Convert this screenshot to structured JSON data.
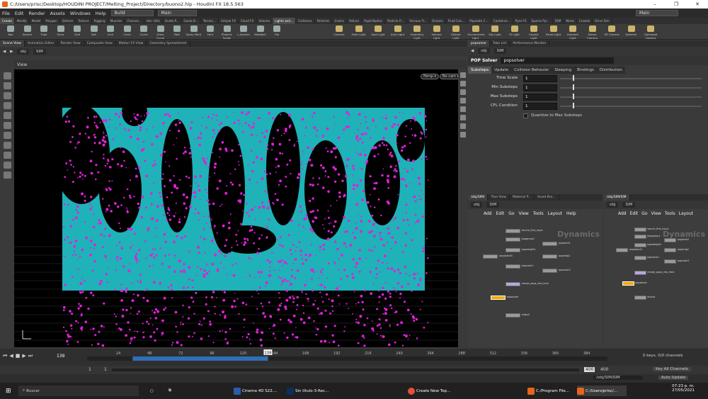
{
  "window": {
    "title": "C:/Users/prisc/Desktop/HOUDINI PROJECT/Melting_Project/Directory/buono2.hip - Houdini FX 18.5.563",
    "controls": [
      "–",
      "❐",
      "✕"
    ]
  },
  "menubar": {
    "items": [
      "File",
      "Edit",
      "Render",
      "Assets",
      "Windows",
      "Help"
    ],
    "build": "Build",
    "main": "Main",
    "main_right": "Main"
  },
  "shelf_tabs": [
    "Create",
    "Modify",
    "Model",
    "Polygon",
    "Deform",
    "Texture",
    "Rigging",
    "Muscles",
    "Charact...",
    "Hair Utils",
    "Guide P...",
    "Guide B...",
    "Terrain...",
    "Simple FX",
    "Cloud FX",
    "Volume",
    "Lights and...",
    "Collisions",
    "Particles",
    "Grains",
    "Vellum",
    "Rigid Bodies",
    "Particle Fl...",
    "Viscous Fl...",
    "Oceans",
    "Fluid Con...",
    "Populate C...",
    "Container...",
    "Pyro FX",
    "Sparse Pyr...",
    "FEM",
    "Wires",
    "Crowds",
    "Drive Sim"
  ],
  "tools_left": [
    "Box",
    "Sphere",
    "Tube",
    "Torus",
    "Grid",
    "Null",
    "Line",
    "Circle",
    "Curve",
    "Draw Curve",
    "Path",
    "Spray Paint",
    "Font",
    "Platonic Solids",
    "L-System",
    "Metaball",
    "File"
  ],
  "tools_right": [
    "Camera",
    "Point Light",
    "Spot Light",
    "Area Light",
    "Geometry Light",
    "Volume Light",
    "Distant Light",
    "Environment Light",
    "Sky Light",
    "GI Light",
    "Caustic Light",
    "Portal Light",
    "Ambient Light",
    "Stereo Camera",
    "VR Camera",
    "Switcher",
    "Gamepad Camera"
  ],
  "left_pane_tabs": [
    "Scene View",
    "Animation Editor",
    "Render View",
    "Composite View",
    "Motion FX View",
    "Geometry Spreadsheet"
  ],
  "path": {
    "obj": "obj",
    "sim": "SIM"
  },
  "viewport": {
    "label": "View",
    "persp": "Persp ▾",
    "cam": "No cam ▾"
  },
  "param_pane": {
    "tabs": [
      "popsolver",
      "Take List",
      "Performance Monitor"
    ],
    "node_type": "POP Solver",
    "node_name": "popsolver",
    "sub_tabs": [
      "Substeps",
      "Update",
      "Collision Behavior",
      "Sleeping",
      "Bindings",
      "Distribution"
    ],
    "params": [
      {
        "label": "Time Scale",
        "value": "1"
      },
      {
        "label": "Min Substeps",
        "value": "1"
      },
      {
        "label": "Max Substeps",
        "value": "1"
      },
      {
        "label": "CFL Condition",
        "value": "1"
      }
    ],
    "quantize": "Quantize to Max Substeps"
  },
  "net_left": {
    "tabs": [
      "/obj/SIM/",
      "Tree View",
      "Material P...",
      "Asset Bro..."
    ],
    "menu": [
      "Add",
      "Edit",
      "Go",
      "View",
      "Tools",
      "Layout",
      "Help"
    ],
    "watermark": "Dynamics",
    "nodes": [
      "source_first_input",
      "popgroup1",
      "popweight1",
      "popobject1",
      "popwind1",
      "popdrag1",
      "popcolor1",
      "popcolor2",
      "merge_pops_into_here",
      "popsolver",
      "output"
    ]
  },
  "net_right": {
    "tabs": [
      "/obj/SIM/SIM"
    ],
    "menu": [
      "Add",
      "Edit",
      "Go",
      "View",
      "Tools",
      "Layout"
    ],
    "watermark": "Dynamics",
    "obj": "obj",
    "sim": "SIM"
  },
  "timeline": {
    "frame": "139",
    "ticks": [
      "24",
      "48",
      "72",
      "96",
      "120",
      "144",
      "168",
      "192",
      "216",
      "240",
      "264",
      "288",
      "312",
      "336",
      "360",
      "384"
    ],
    "start": "1",
    "start2": "1",
    "end": "400",
    "end2": "400",
    "marker": "139"
  },
  "status": {
    "keys": "0 keys, 0/0 channels",
    "key_all": "Key All Channels",
    "path": "/obj/SIM/SIM",
    "auto": "Auto Update"
  },
  "taskbar": {
    "search": "Buscar",
    "apps": [
      "Cinema 4D S22....",
      "Sin título-3-Rec...",
      "Create New Top...",
      "C:/Program File...",
      "C:/Users/prisc/..."
    ],
    "time": "07:23 p. m.",
    "date": "27/05/2021"
  },
  "colors": {
    "cyan": "#1fb2b8",
    "magenta": "#e020d8",
    "accent": "#f2a900"
  }
}
